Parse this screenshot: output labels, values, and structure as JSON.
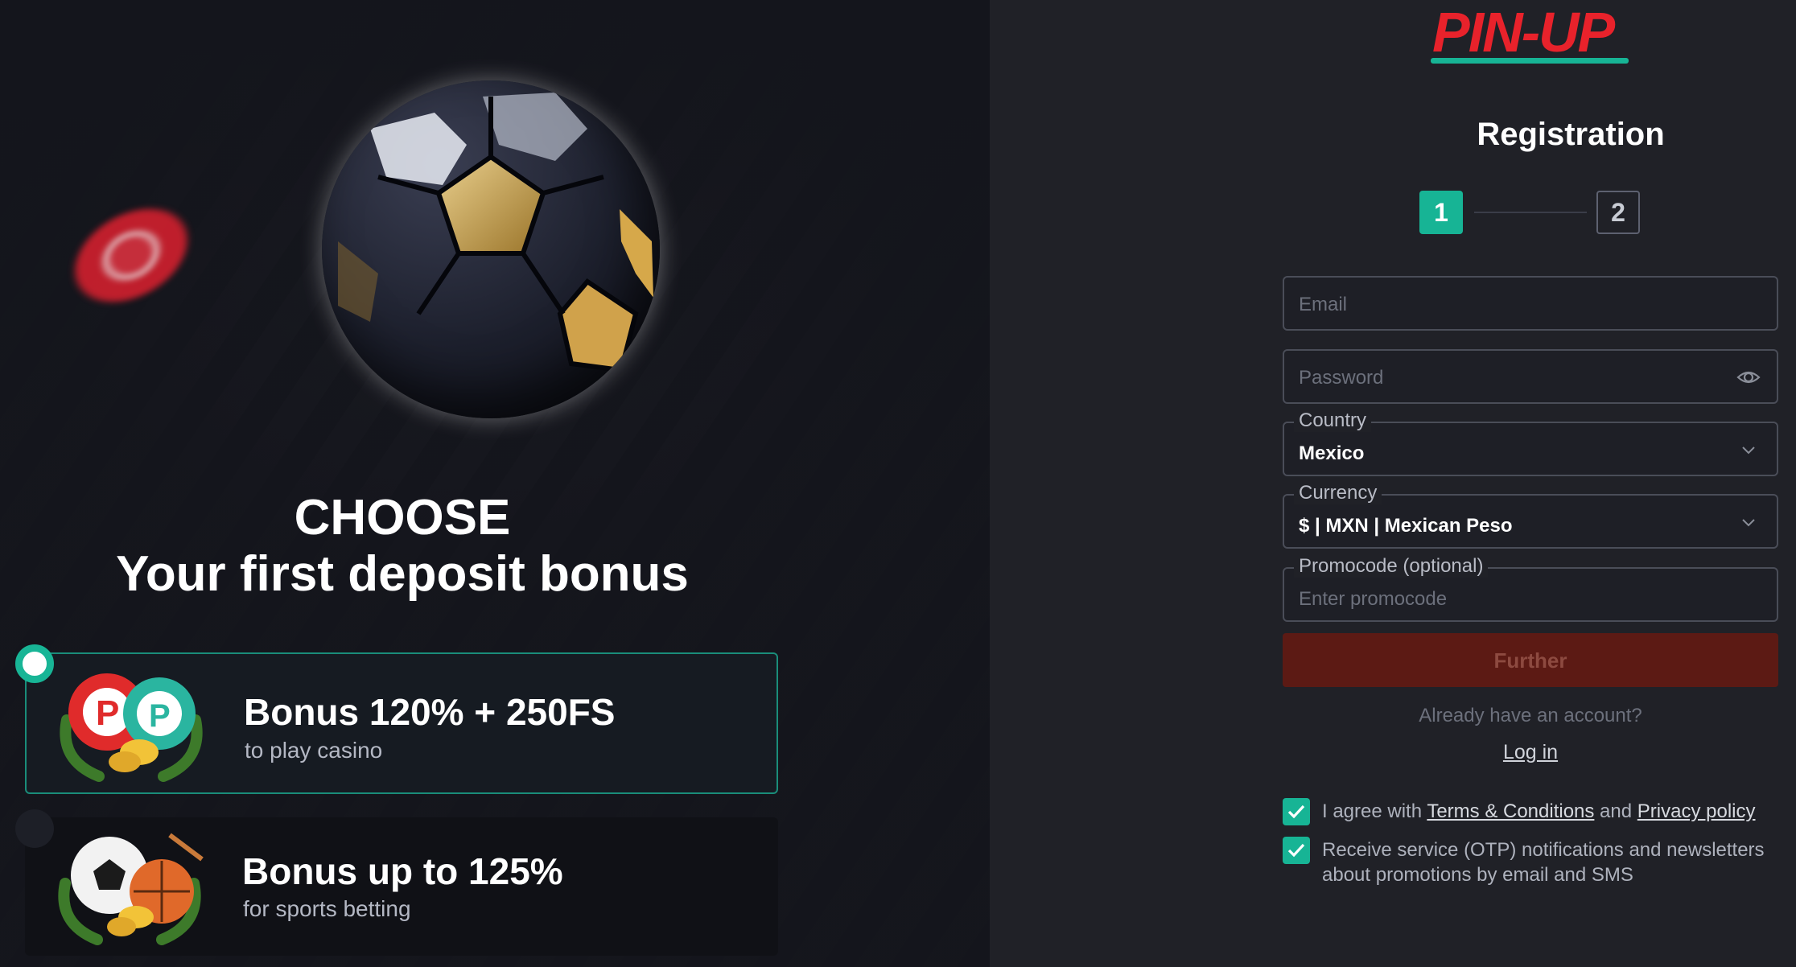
{
  "promo": {
    "headline_line1": "CHOOSE",
    "headline_line2": "Your first deposit bonus",
    "bonuses": [
      {
        "title": "Bonus 120% + 250FS",
        "subtitle": "to play casino",
        "selected": true
      },
      {
        "title": "Bonus up to 125%",
        "subtitle": "for sports betting",
        "selected": false
      }
    ]
  },
  "form": {
    "logo_text": "PIN-UP",
    "title": "Registration",
    "steps": [
      "1",
      "2"
    ],
    "current_step": 1,
    "email": {
      "placeholder": "Email",
      "value": ""
    },
    "password": {
      "placeholder": "Password",
      "value": ""
    },
    "country": {
      "label": "Country",
      "value": "Mexico"
    },
    "currency": {
      "label": "Currency",
      "value": "$ | MXN | Mexican Peso"
    },
    "promocode": {
      "label": "Promocode (optional)",
      "placeholder": "Enter promocode"
    },
    "further_label": "Further",
    "already_text": "Already have an account?",
    "login_label": "Log in",
    "agreements": {
      "prefix": "I agree with ",
      "terms_label": "Terms & Conditions",
      "and": " and ",
      "privacy_label": "Privacy policy",
      "newsletter": "Receive service (OTP) notifications and newsletters about promotions by email and SMS",
      "terms_checked": true,
      "newsletter_checked": true
    }
  },
  "colors": {
    "accent": "#17b495",
    "brand_red": "#e8222b",
    "button_disabled": "#5c1a14",
    "background": "#202127"
  },
  "icons": [
    "eye-icon",
    "chevron-down-icon",
    "check-icon",
    "soccer-ball-image",
    "casino-chip-image"
  ]
}
